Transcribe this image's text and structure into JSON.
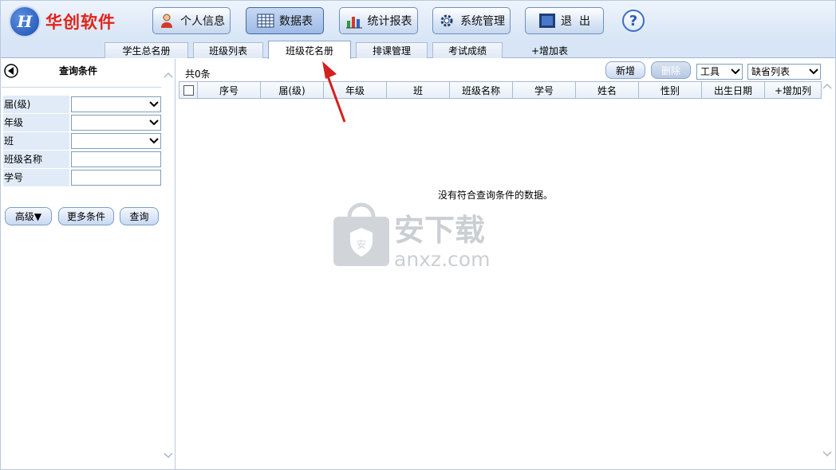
{
  "app": {
    "logo_text": "华创软件",
    "logo_mark": "H"
  },
  "toolbar": {
    "buttons": [
      {
        "label": "个人信息",
        "icon": "person-icon"
      },
      {
        "label": "数据表",
        "icon": "table-icon",
        "active": true
      },
      {
        "label": "统计报表",
        "icon": "chart-icon"
      },
      {
        "label": "系统管理",
        "icon": "gear-icon"
      },
      {
        "label": "退  出",
        "icon": "exit-icon"
      }
    ],
    "help": "?"
  },
  "tabs": [
    "学生总名册",
    "班级列表",
    "班级花名册",
    "排课管理",
    "考试成绩",
    "+增加表"
  ],
  "active_tab": "班级花名册",
  "query": {
    "title": "查询条件",
    "fields": [
      {
        "label": "届(级)",
        "type": "select",
        "value": ""
      },
      {
        "label": "年级",
        "type": "select",
        "value": ""
      },
      {
        "label": "班",
        "type": "select",
        "value": ""
      },
      {
        "label": "班级名称",
        "type": "text",
        "value": ""
      },
      {
        "label": "学号",
        "type": "text",
        "value": ""
      }
    ],
    "buttons": {
      "advanced": "高级▼",
      "more": "更多条件",
      "search": "查询"
    }
  },
  "main": {
    "count": "共0条",
    "new_label": "新增",
    "delete_label": "删除",
    "tools_select": "工具",
    "view_select": "缺省列表",
    "columns": [
      "序号",
      "届(级)",
      "年级",
      "班",
      "班级名称",
      "学号",
      "姓名",
      "性别",
      "出生日期",
      "+增加列"
    ],
    "empty_message": "没有符合查询条件的数据。"
  },
  "watermark": {
    "title": "安下载",
    "url": "anxz.com"
  },
  "colors": {
    "logo_red": "#e0231a",
    "annotation_arrow": "#d42020",
    "header_bg": "#d7e5f6"
  }
}
